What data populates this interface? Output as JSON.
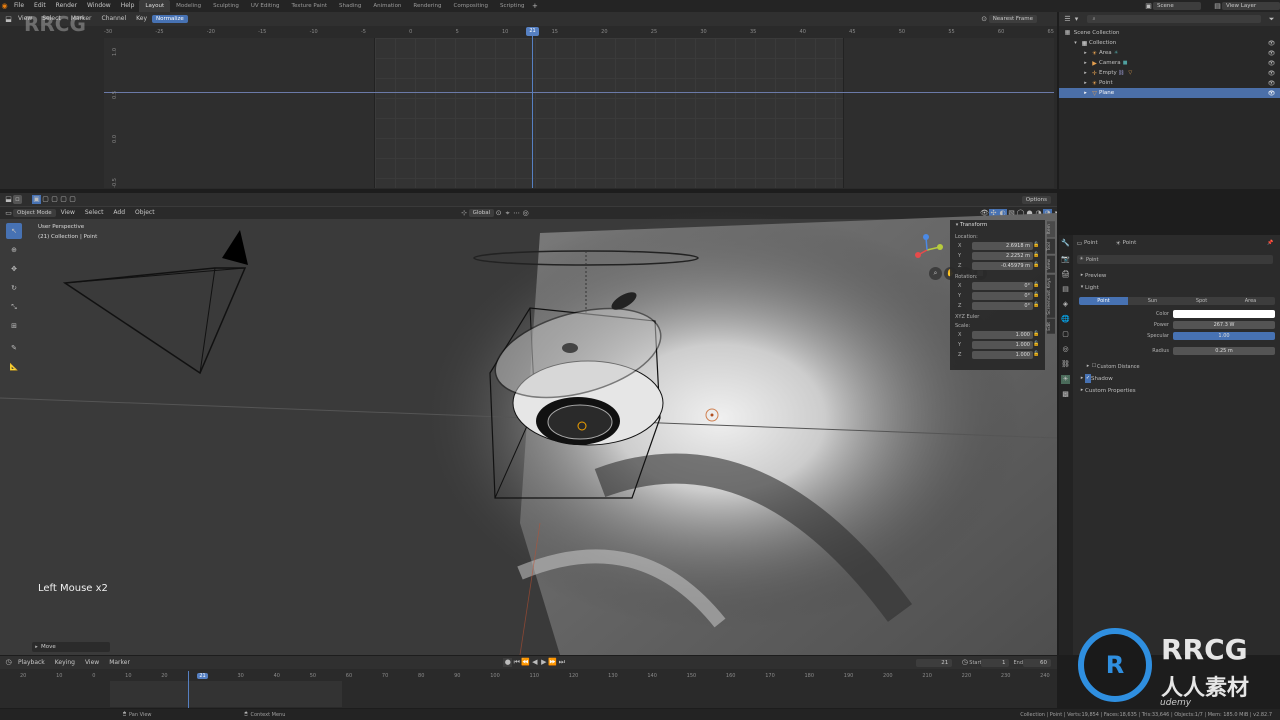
{
  "menu": [
    "File",
    "Edit",
    "Render",
    "Window",
    "Help"
  ],
  "workspaces": [
    "Layout",
    "Modeling",
    "Sculpting",
    "UV Editing",
    "Texture Paint",
    "Shading",
    "Animation",
    "Rendering",
    "Compositing",
    "Scripting"
  ],
  "scene": {
    "name": "Scene",
    "view_layer": "View Layer"
  },
  "graph_editor": {
    "menus": [
      "View",
      "Select",
      "Marker",
      "Channel",
      "Key"
    ],
    "normalization": "Normalize",
    "frame_mode": "Nearest Frame",
    "ruler": [
      "-30",
      "-25",
      "-20",
      "-15",
      "-10",
      "-5",
      "0",
      "5",
      "10",
      "15",
      "20",
      "25",
      "30",
      "35",
      "40",
      "45",
      "50",
      "55",
      "60",
      "65"
    ],
    "current_frame": "21",
    "y_ticks": [
      "1.5",
      "1.0",
      "0.5",
      "0.0",
      "-0.5",
      "-1.0"
    ]
  },
  "outliner": {
    "root": "Scene Collection",
    "items": [
      "Collection",
      "Area",
      "Camera",
      "Empty",
      "Point",
      "Plane"
    ]
  },
  "viewport": {
    "mode": "Object Mode",
    "menus": [
      "View",
      "Select",
      "Add",
      "Object"
    ],
    "orientation": "Global",
    "options": "Options",
    "perspective": "User Perspective",
    "collection_info": "(21) Collection | Point",
    "key_hint": "Left Mouse x2",
    "operator": "Move"
  },
  "n_panel": {
    "title": "Transform",
    "location_label": "Location:",
    "location": [
      {
        "axis": "X",
        "value": "2.6918 m"
      },
      {
        "axis": "Y",
        "value": "2.2252 m"
      },
      {
        "axis": "Z",
        "value": "-0.45979 m"
      }
    ],
    "rotation_label": "Rotation:",
    "rotation": [
      {
        "axis": "X",
        "value": "0°"
      },
      {
        "axis": "Y",
        "value": "0°"
      },
      {
        "axis": "Z",
        "value": "0°"
      }
    ],
    "rotation_mode": "XYZ Euler",
    "scale_label": "Scale:",
    "scale": [
      {
        "axis": "X",
        "value": "1.000"
      },
      {
        "axis": "Y",
        "value": "1.000"
      },
      {
        "axis": "Z",
        "value": "1.000"
      }
    ],
    "tabs": [
      "Item",
      "Tool",
      "View",
      "Screencast Keys",
      "Edit"
    ]
  },
  "properties": {
    "object": "Point",
    "data": "Point",
    "datablock": "Point",
    "sections": {
      "preview": "Preview",
      "light": "Light"
    },
    "light_types": [
      "Point",
      "Sun",
      "Spot",
      "Area"
    ],
    "color_label": "Color",
    "power_label": "Power",
    "power_value": "267.3 W",
    "specular_label": "Specular",
    "specular_value": "1.00",
    "radius_label": "Radius",
    "radius_value": "0.25 m",
    "custom_distance": "Custom Distance",
    "shadow": "Shadow",
    "custom_props": "Custom Properties"
  },
  "timeline": {
    "menus": [
      "Playback",
      "Keying",
      "View",
      "Marker"
    ],
    "current": "21",
    "start_label": "Start",
    "start": "1",
    "end_label": "End",
    "end": "60",
    "ruler": [
      "20",
      "10",
      "0",
      "10",
      "20",
      "21",
      "30",
      "40",
      "50",
      "60",
      "70",
      "80",
      "90",
      "100",
      "110",
      "120",
      "130",
      "140",
      "150",
      "160",
      "170",
      "180",
      "190",
      "200",
      "210",
      "220",
      "230",
      "240"
    ]
  },
  "statusbar": {
    "left1": "Pan View",
    "left2": "Context Menu",
    "right": "Collection | Point | Verts:19,854 | Faces:18,635 | Tris:33,646 | Objects:1/7 | Mem: 185.0 MiB | v2.82.7"
  },
  "watermarks": {
    "rrcg": "RRCG",
    "cn": "人人素材",
    "brand": "udemy"
  },
  "colors": {
    "accent": "#4772b3",
    "frame": "#5680c2",
    "bg": "#2b2b2b"
  }
}
